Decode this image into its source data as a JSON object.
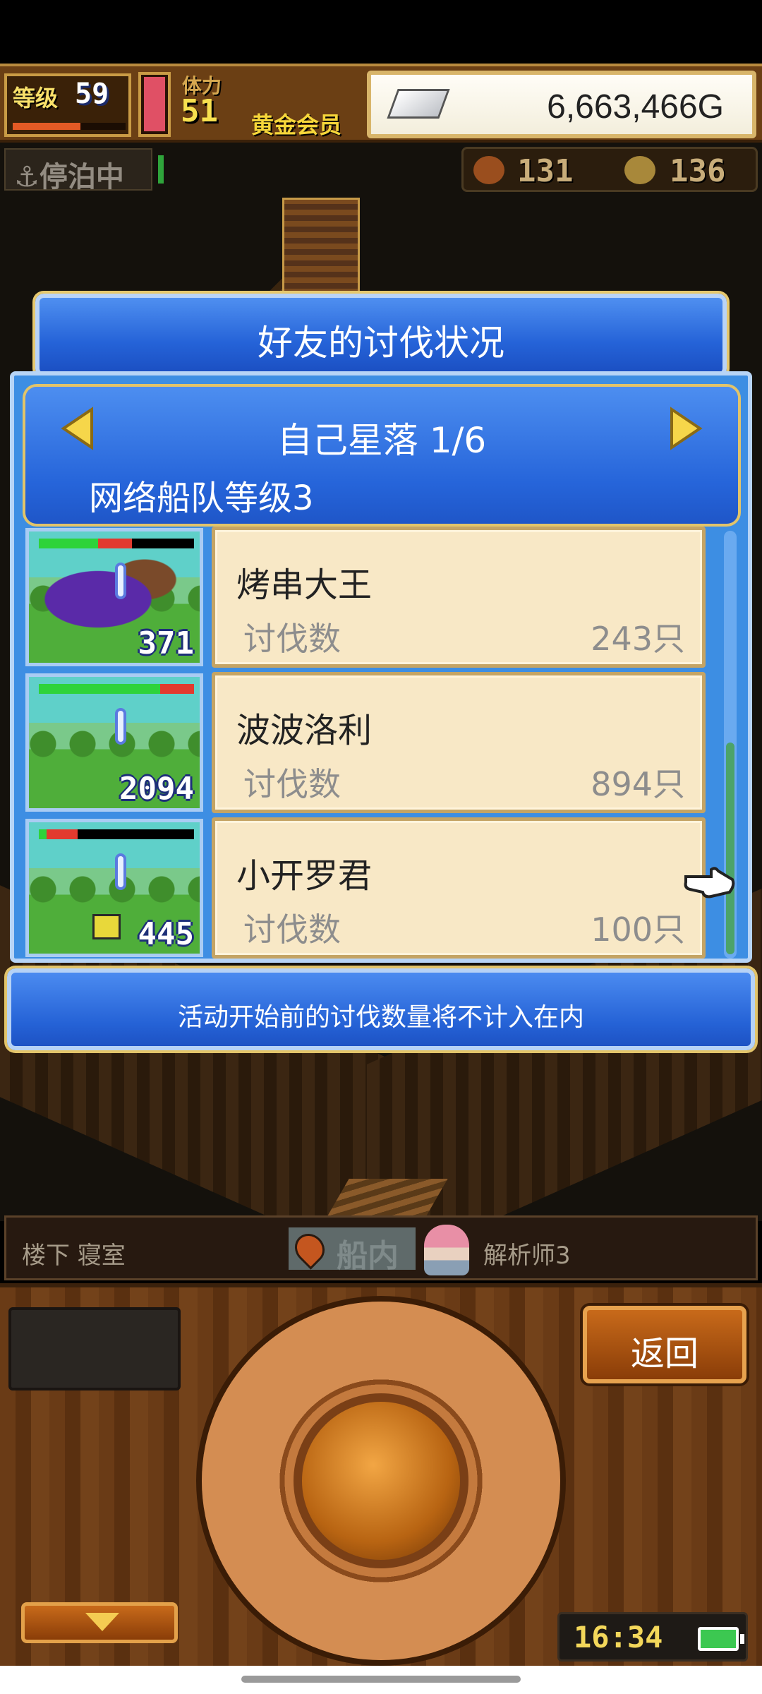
{
  "hud": {
    "level_label": "等级",
    "level_value": "59",
    "xp_fraction": 0.6,
    "hp_fraction": 0.92,
    "stamina_label": "体力",
    "stamina_value": "51",
    "member_badge": "黄金会员",
    "gold_value": "6,663,466G"
  },
  "status": {
    "anchor_text": "停泊中",
    "resource_1": "131",
    "resource_2": "136"
  },
  "dialog": {
    "title": "好友的讨伐状况",
    "group_title": "自己星落 1/6",
    "group_level": "网络船队等级3",
    "rows": [
      {
        "score": "371",
        "name": "烤串大王",
        "kill_label": "讨伐数",
        "kill_count": "243只",
        "hp_green": 0.38,
        "hp_red": 0.22
      },
      {
        "score": "2094",
        "name": "波波洛利",
        "kill_label": "讨伐数",
        "kill_count": "894只",
        "hp_green": 0.78,
        "hp_red": 0.22
      },
      {
        "score": "445",
        "name": "小开罗君",
        "kill_label": "讨伐数",
        "kill_count": "100只",
        "hp_green": 0.05,
        "hp_red": 0.2
      }
    ],
    "notice": "活动开始前的讨伐数量将不计入在内"
  },
  "location": {
    "room": "楼下 寝室",
    "ship_tab": "船内",
    "analyst": "解析师3"
  },
  "controls": {
    "back_label": "返回",
    "clock": "16:34"
  }
}
